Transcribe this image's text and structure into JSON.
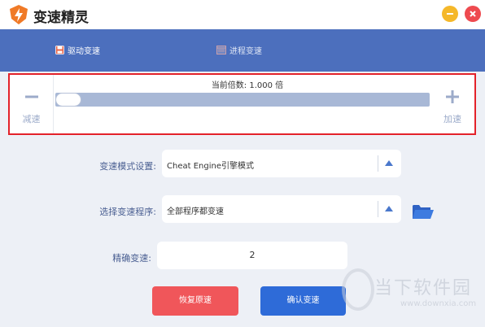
{
  "app": {
    "title": "变速精灵",
    "accent_color": "#4c6fbd",
    "icons": {
      "logo": "lightning-shield-icon",
      "minimize": "minus-icon",
      "close": "close-icon"
    }
  },
  "nav": {
    "tabs": [
      {
        "label": "驱动变速",
        "icon": "disk-icon",
        "active": true
      },
      {
        "label": "进程变速",
        "icon": "window-icon",
        "active": false
      }
    ]
  },
  "speed_panel": {
    "decrease_label": "减速",
    "decrease_icon": "minus-icon",
    "increase_label": "加速",
    "increase_icon": "plus-icon",
    "multiplier_text": "当前倍数: 1.000 倍",
    "slider_value": 1.0
  },
  "form": {
    "mode": {
      "label": "变速模式设置:",
      "value": "Cheat Engine引擎模式",
      "icon": "triangle-up-icon"
    },
    "program": {
      "label": "选择变速程序:",
      "value": "全部程序都变速",
      "icon": "triangle-up-icon",
      "browse_icon": "folder-icon"
    },
    "precise": {
      "label": "精确变速:",
      "value": "2"
    }
  },
  "buttons": {
    "restore": "恢复原速",
    "confirm": "确认变速"
  },
  "watermark": {
    "title": "当下软件园",
    "url": "www.downxia.com"
  }
}
